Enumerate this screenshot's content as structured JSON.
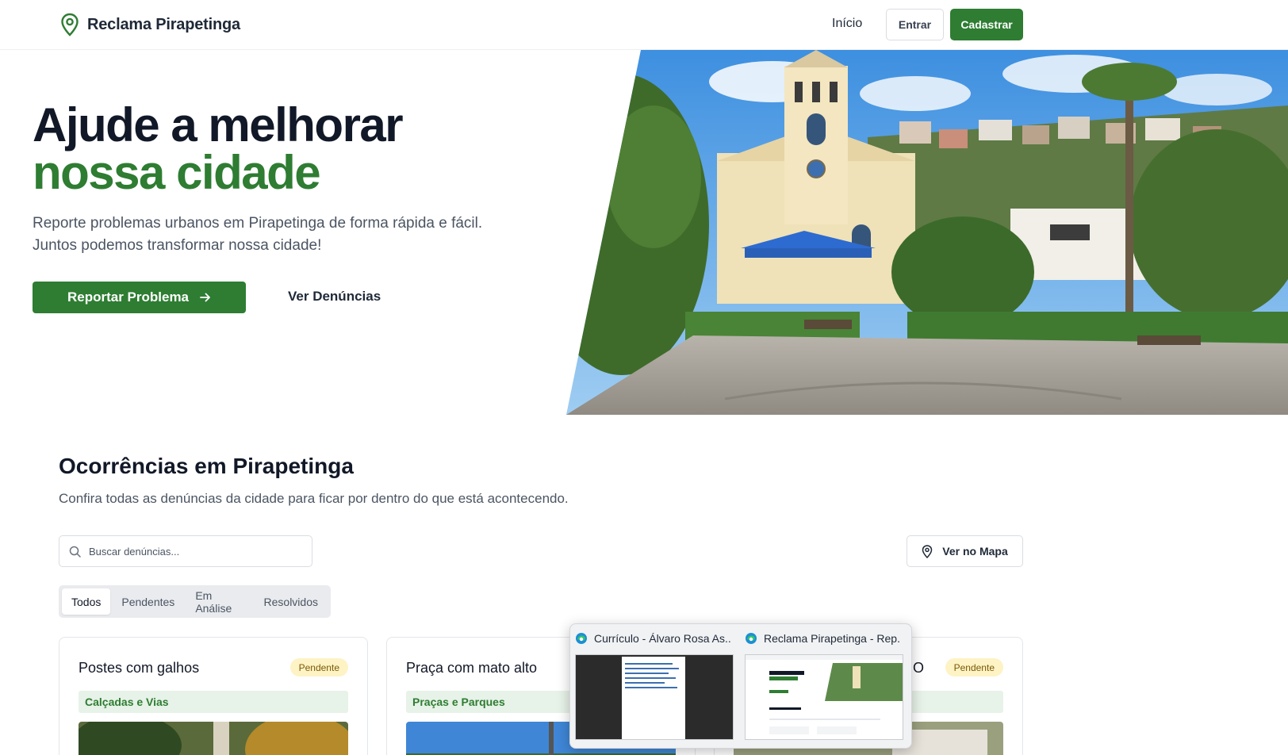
{
  "header": {
    "brand": "Reclama Pirapetinga",
    "nav_inicio": "Início",
    "entrar": "Entrar",
    "cadastrar": "Cadastrar"
  },
  "hero": {
    "title_line1": "Ajude a melhorar",
    "title_line2": "nossa cidade",
    "description": "Reporte problemas urbanos em Pirapetinga de forma rápida e fácil. Juntos podemos transformar nossa cidade!",
    "report_button": "Reportar Problema",
    "view_button": "Ver Denúncias"
  },
  "section": {
    "title": "Ocorrências em Pirapetinga",
    "subtitle": "Confira todas as denúncias da cidade para ficar por dentro do que está acontecendo.",
    "search_placeholder": "Buscar denúncias...",
    "map_button": "Ver no Mapa",
    "tabs": [
      "Todos",
      "Pendentes",
      "Em Análise",
      "Resolvidos"
    ]
  },
  "cards": [
    {
      "title": "Postes com galhos",
      "status": "Pendente",
      "category": "Calçadas e Vias"
    },
    {
      "title": "Praça com mato alto",
      "status": "",
      "category": "Praças e Parques"
    },
    {
      "title": "O",
      "status": "Pendente",
      "category": ""
    }
  ],
  "taskbar_previews": [
    {
      "title": "Currículo - Álvaro Rosa As...",
      "icon": "edge-icon"
    },
    {
      "title": "Reclama Pirapetinga - Rep...",
      "icon": "edge-icon"
    }
  ],
  "colors": {
    "brand_green": "#2e7d32",
    "pending_badge": "#fdf3c4",
    "category_bg": "#e7f2e8"
  }
}
